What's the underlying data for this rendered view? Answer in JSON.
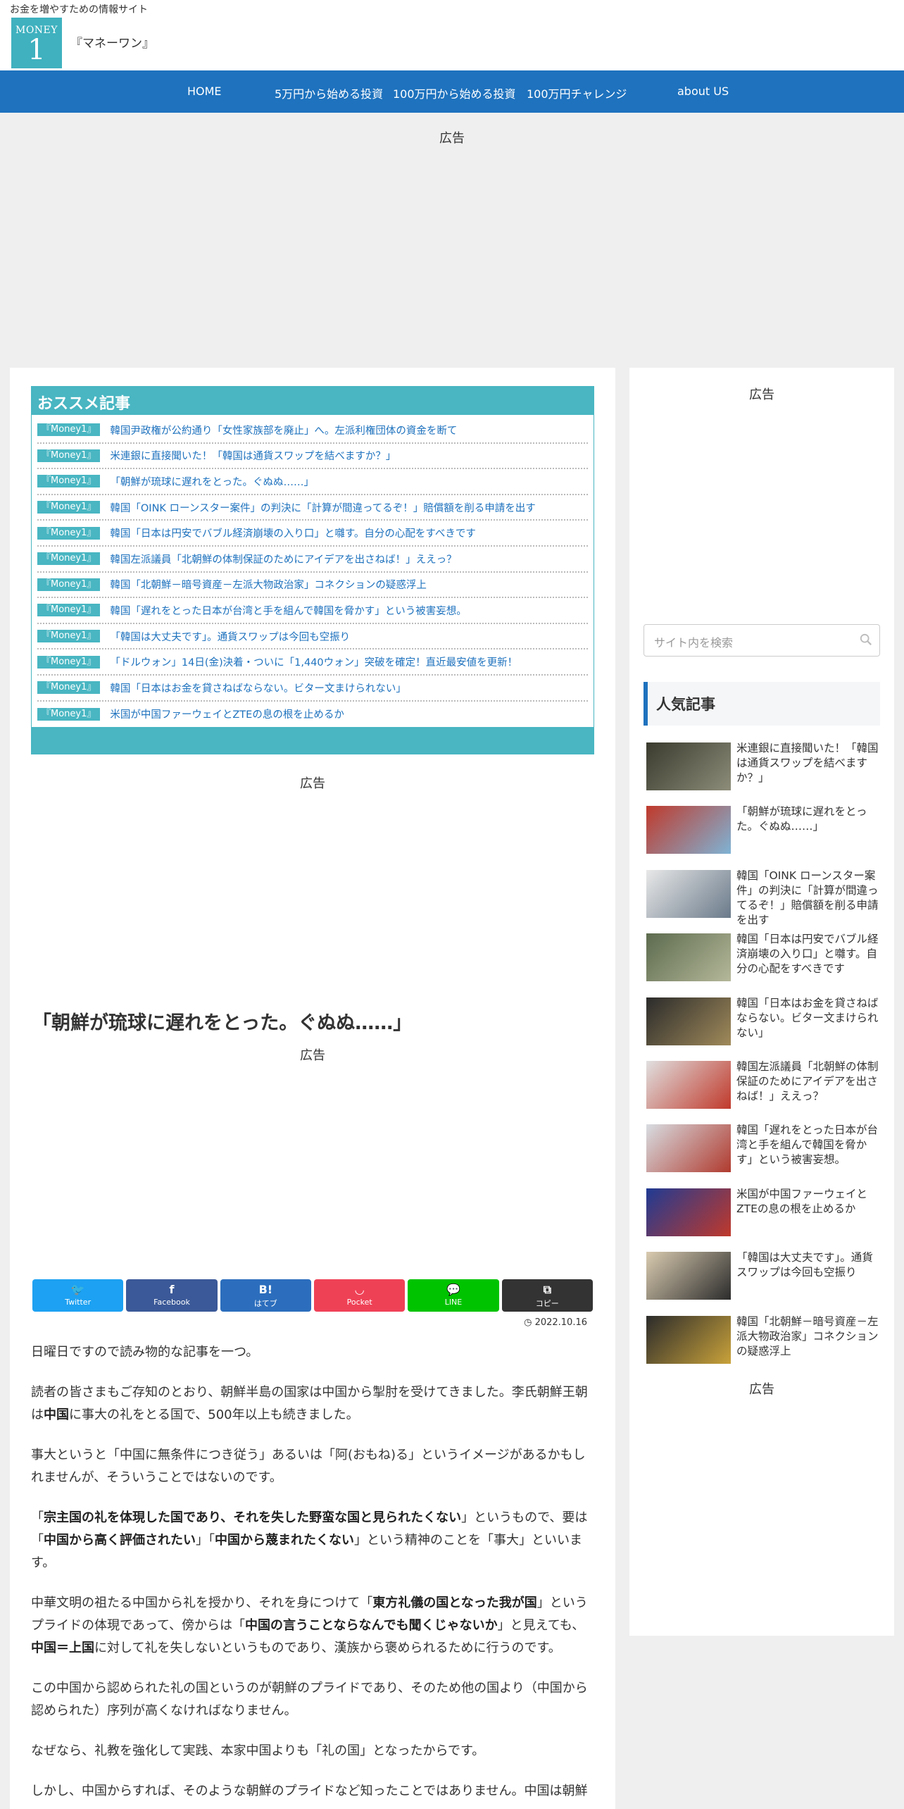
{
  "header": {
    "tagline": "お金を増やすための情報サイト",
    "logo_small": "MONEY",
    "logo_big": "1",
    "site_name": "『マネーワン』"
  },
  "nav": {
    "items": [
      "HOME",
      "5万円から始める投資",
      "100万円から始める投資",
      "100万円チャレンジ",
      "about US"
    ]
  },
  "ads": {
    "label": "広告"
  },
  "recommended": {
    "heading": "おススメ記事",
    "items": [
      {
        "badge": "『Money1』",
        "title": "韓国尹政権が公約通り「女性家族部を廃止」へ。左派利権団体の資金を断て"
      },
      {
        "badge": "『Money1』",
        "title": "米連銀に直接聞いた！「韓国は通貨スワップを結べますか？」"
      },
      {
        "badge": "『Money1』",
        "title": "「朝鮮が琉球に遅れをとった。ぐぬぬ……」"
      },
      {
        "badge": "『Money1』",
        "title": "韓国「OINK ローンスター案件」の判決に「計算が間違ってるぞ！」賠償額を削る申請を出す"
      },
      {
        "badge": "『Money1』",
        "title": "韓国「日本は円安でバブル経済崩壊の入り口」と囃す。自分の心配をすべきです"
      },
      {
        "badge": "『Money1』",
        "title": "韓国左派議員「北朝鮮の体制保証のためにアイデアを出さねば！」ええっ？"
      },
      {
        "badge": "『Money1』",
        "title": "韓国「北朝鮮－暗号資産－左派大物政治家」コネクションの疑惑浮上"
      },
      {
        "badge": "『Money1』",
        "title": "韓国「遅れをとった日本が台湾と手を組んで韓国を脅かす」という被害妄想。"
      },
      {
        "badge": "『Money1』",
        "title": "「韓国は大丈夫です」。通貨スワップは今回も空振り"
      },
      {
        "badge": "『Money1』",
        "title": "「ドルウォン」14日(金)決着・ついに「1,440ウォン」突破を確定！直近最安値を更新！"
      },
      {
        "badge": "『Money1』",
        "title": "韓国「日本はお金を貸さねばならない。ビター文まけられない」"
      },
      {
        "badge": "『Money1』",
        "title": "米国が中国ファーウェイとZTEの息の根を止めるか"
      }
    ]
  },
  "article": {
    "title": "「朝鮮が琉球に遅れをとった。ぐぬぬ……」",
    "date": "2022.10.16",
    "share": [
      {
        "label": "Twitter",
        "icon": "twitter-icon",
        "glyph": "🐦",
        "color": "#1da1f2"
      },
      {
        "label": "Facebook",
        "icon": "facebook-icon",
        "glyph": "f",
        "color": "#3b5998"
      },
      {
        "label": "はてブ",
        "icon": "hatena-icon",
        "glyph": "B!",
        "color": "#2c6ebd"
      },
      {
        "label": "Pocket",
        "icon": "pocket-icon",
        "glyph": "◡",
        "color": "#ef4156"
      },
      {
        "label": "LINE",
        "icon": "line-icon",
        "glyph": "💬",
        "color": "#00c300"
      },
      {
        "label": "コピー",
        "icon": "copy-icon",
        "glyph": "⧉",
        "color": "#333333"
      }
    ],
    "p1": "日曜日ですので読み物的な記事を一つ。",
    "p2_a": "読者の皆さまもご存知のとおり、朝鮮半島の国家は中国から掣肘を受けてきました。李氏朝鮮王朝は",
    "p2_b": "中国",
    "p2_c": "に事大の礼をとる国で、500年以上も続きました。",
    "p3": "事大というと「中国に無条件につき従う」あるいは「阿(おもね)る」というイメージがあるかもしれませんが、そういうことではないのです。",
    "p4_a": "「",
    "p4_b": "宗主国の礼を体現した国であり、それを失した野蛮な国と見られたくない",
    "p4_c": "」というもので、要は「",
    "p4_d": "中国から高く評価されたい",
    "p4_e": "」「",
    "p4_f": "中国から蔑まれたくない",
    "p4_g": "」という精神のことを「事大」といいます。",
    "p5_a": "中華文明の祖たる中国から礼を授かり、それを身につけて「",
    "p5_b": "東方礼儀の国となった我が国",
    "p5_c": "」というプライドの体現であって、傍からは「",
    "p5_d": "中国の言うことならなんでも聞くじゃないか",
    "p5_e": "」と見えても、",
    "p5_f": "中国＝上国",
    "p5_g": "に対して礼を失しないというものであり、漢族から褒められるために行うのです。",
    "p6": "この中国から認められた礼の国というのが朝鮮のプライドであり、そのため他の国より（中国から認められた）序列が高くなければなりません。",
    "p7": "なぜなら、礼教を強化して実践、本家中国よりも「礼の国」となったからです。",
    "p8": "しかし、中国からすれば、そのような朝鮮のプライドなど知ったことではありません。中国は朝鮮"
  },
  "sidebar": {
    "search_placeholder": "サイト内を検索",
    "popular_heading": "人気記事",
    "popular": [
      {
        "title": "米連銀に直接聞いた！「韓国は通貨スワップを結べますか？」",
        "colors": [
          "#3a3a2e",
          "#8d8d7a"
        ]
      },
      {
        "title": "「朝鮮が琉球に遅れをとった。ぐぬぬ……」",
        "colors": [
          "#c0392b",
          "#7fb3d5"
        ]
      },
      {
        "title": "韓国「OINK ローンスター案件」の判決に「計算が間違ってるぞ！」賠償額を削る申請を出す",
        "colors": [
          "#e8e8e8",
          "#6a7a8a"
        ]
      },
      {
        "title": "韓国「日本は円安でバブル経済崩壊の入り口」と囃す。自分の心配をすべきです",
        "colors": [
          "#5d6b4e",
          "#b5b89a"
        ]
      },
      {
        "title": "韓国「日本はお金を貸さねばならない。ビター文まけられない」",
        "colors": [
          "#2b2b2b",
          "#a08a5a"
        ]
      },
      {
        "title": "韓国左派議員「北朝鮮の体制保証のためにアイデアを出さねば！」ええっ？",
        "colors": [
          "#e0e0e0",
          "#c0392b"
        ]
      },
      {
        "title": "韓国「遅れをとった日本が台湾と手を組んで韓国を脅かす」という被害妄想。",
        "colors": [
          "#d8dde2",
          "#b03a2e"
        ]
      },
      {
        "title": "米国が中国ファーウェイとZTEの息の根を止めるか",
        "colors": [
          "#1f3a93",
          "#c0392b"
        ]
      },
      {
        "title": "「韓国は大丈夫です」。通貨スワップは今回も空振り",
        "colors": [
          "#d9cbb0",
          "#2c2c2c"
        ]
      },
      {
        "title": "韓国「北朝鮮－暗号資産－左派大物政治家」コネクションの疑惑浮上",
        "colors": [
          "#2b2b2b",
          "#c9a23a"
        ]
      }
    ]
  }
}
